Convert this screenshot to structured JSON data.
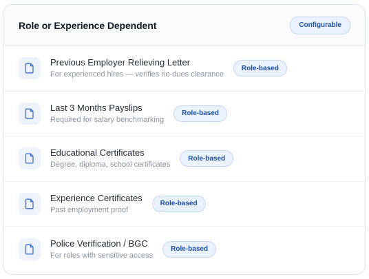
{
  "section": {
    "title": "Role or Experience Dependent",
    "badge": "Configurable"
  },
  "documents": [
    {
      "title": "Previous Employer Relieving Letter",
      "subtitle": "For experienced hires — verifies no-dues clearance",
      "badge": "Role-based",
      "icon": "document-icon"
    },
    {
      "title": "Last 3 Months Payslips",
      "subtitle": "Required for salary benchmarking",
      "badge": "Role-based",
      "icon": "document-icon"
    },
    {
      "title": "Educational Certificates",
      "subtitle": "Degree, diploma, school certificates",
      "badge": "Role-based",
      "icon": "document-icon"
    },
    {
      "title": "Experience Certificates",
      "subtitle": "Past employment proof",
      "badge": "Role-based",
      "icon": "document-icon"
    },
    {
      "title": "Police Verification / BGC",
      "subtitle": "For roles with sensitive access",
      "badge": "Role-based",
      "icon": "document-icon"
    }
  ],
  "colors": {
    "badge_text": "#1d4fa8",
    "badge_bg": "#eaf2fe",
    "icon_stroke": "#3b6fc9"
  }
}
